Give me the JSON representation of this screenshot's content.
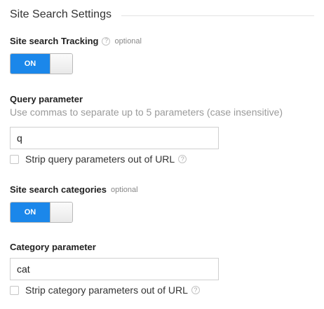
{
  "section": {
    "title": "Site Search Settings"
  },
  "tracking": {
    "label": "Site search Tracking",
    "help_icon": "?",
    "optional": "optional",
    "toggle_label": "ON"
  },
  "query": {
    "label": "Query parameter",
    "hint": "Use commas to separate up to 5 parameters (case insensitive)",
    "value": "q",
    "strip_label": "Strip query parameters out of URL",
    "help_icon": "?"
  },
  "categories": {
    "label": "Site search categories",
    "optional": "optional",
    "toggle_label": "ON"
  },
  "category_param": {
    "label": "Category parameter",
    "value": "cat",
    "strip_label": "Strip category parameters out of URL",
    "help_icon": "?"
  },
  "colors": {
    "toggle_on": "#1b87ea",
    "label_text": "#222222",
    "hint_text": "#9a9a9a"
  }
}
